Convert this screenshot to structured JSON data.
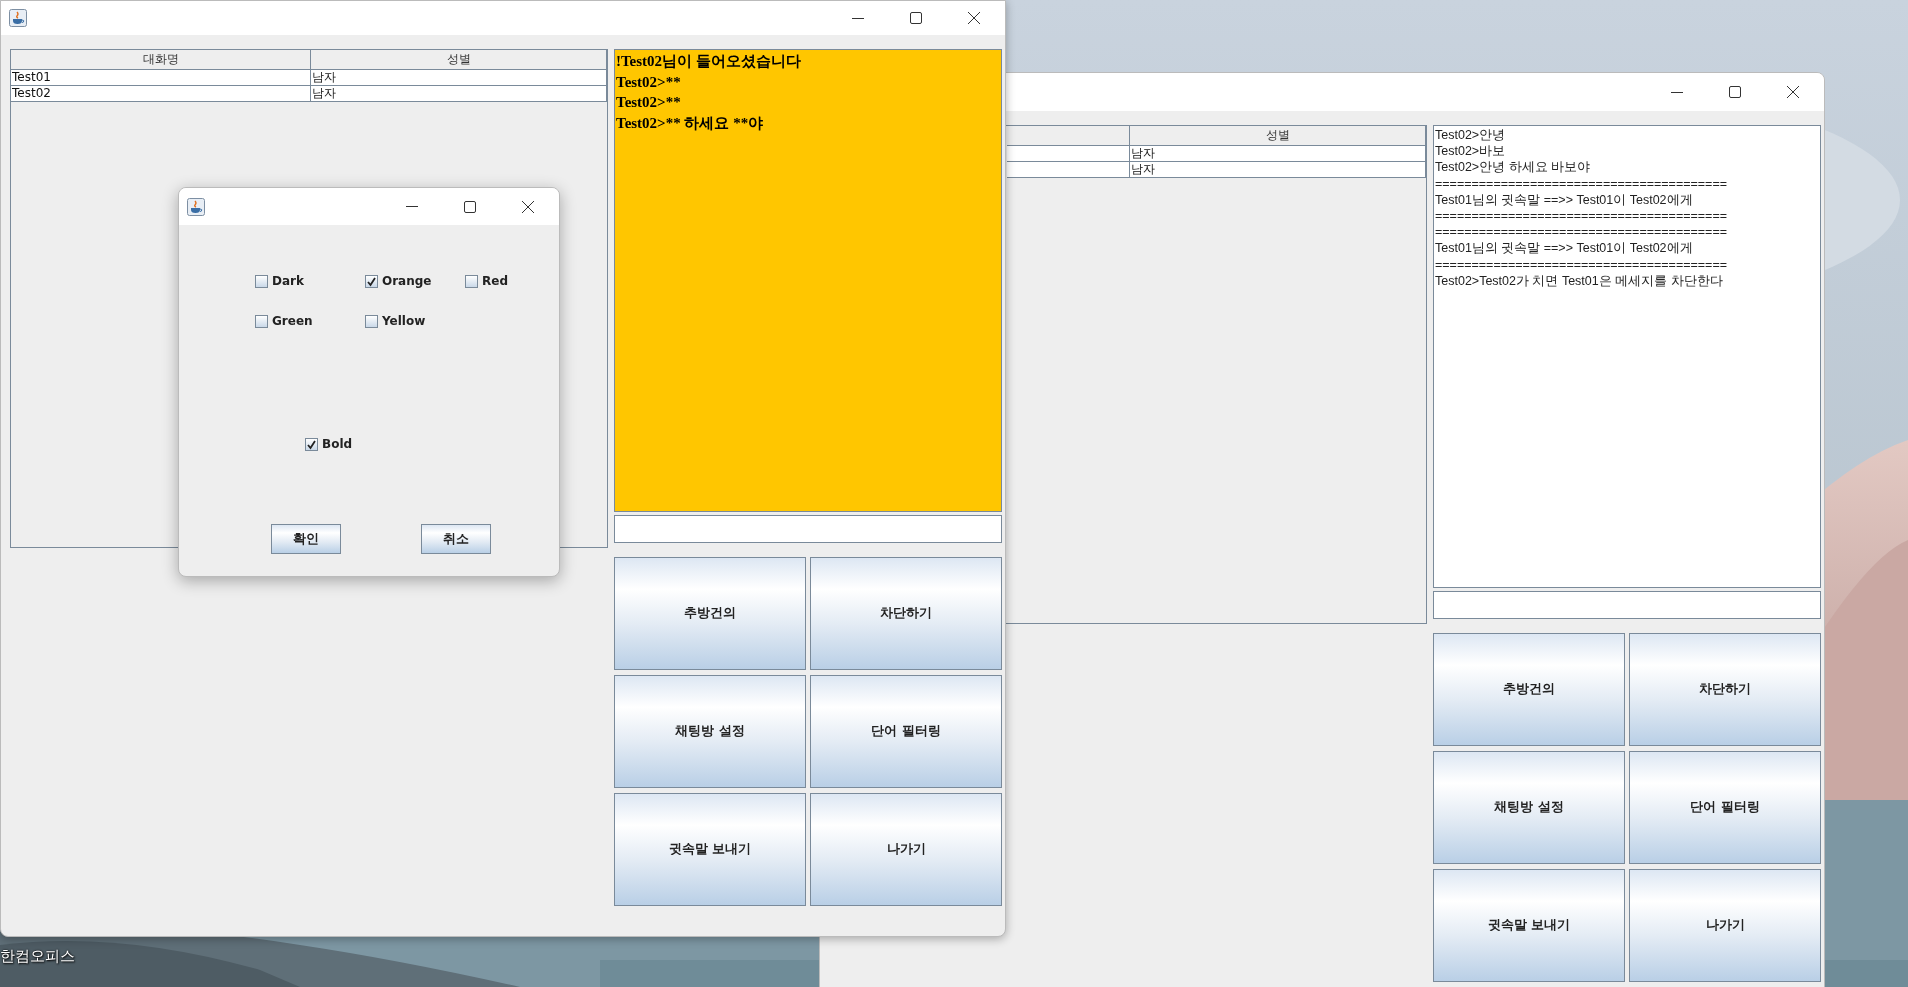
{
  "desktop": {
    "icon_label": "한컴오피스"
  },
  "windows": [
    {
      "table": {
        "columns": [
          "대화명",
          "성별"
        ],
        "rows": [
          [
            "Test01",
            "남자"
          ],
          [
            "Test02",
            "남자"
          ]
        ]
      },
      "chat": {
        "color": "#ffc600",
        "bold": true,
        "lines": [
          "!Test02님이 들어오셨습니다",
          "Test02>**",
          "Test02>**",
          "Test02>** 하세요 **야"
        ]
      },
      "buttons": [
        "추방건의",
        "차단하기",
        "채팅방 설정",
        "단어 필터링",
        "귓속말 보내기",
        "나가기"
      ]
    },
    {
      "table": {
        "columns": [
          null,
          "성별"
        ],
        "rows": [
          [
            null,
            "남자"
          ],
          [
            null,
            "남자"
          ]
        ]
      },
      "chat": {
        "color": "#ffffff",
        "bold": false,
        "lines": [
          "Test02>안녕",
          "Test02>바보",
          "Test02>안녕 하세요 바보야",
          "========================================",
          "Test01님의 귓속말 ==>> Test01이 Test02에게",
          "========================================",
          "========================================",
          "Test01님의 귓속말 ==>> Test01이 Test02에게",
          "========================================",
          "Test02>Test02가 치면 Test01은 메세지를 차단한다"
        ]
      },
      "buttons": [
        "추방건의",
        "차단하기",
        "채팅방 설정",
        "단어 필터링",
        "귓속말 보내기",
        "나가기"
      ]
    }
  ],
  "dialog": {
    "color_options": [
      {
        "label": "Dark",
        "checked": false
      },
      {
        "label": "Orange",
        "checked": true
      },
      {
        "label": "Red",
        "checked": false
      },
      {
        "label": "Green",
        "checked": false
      },
      {
        "label": "Yellow",
        "checked": false
      }
    ],
    "style_options": [
      {
        "label": "Bold",
        "checked": true
      }
    ],
    "buttons": [
      "확인",
      "취소"
    ]
  }
}
